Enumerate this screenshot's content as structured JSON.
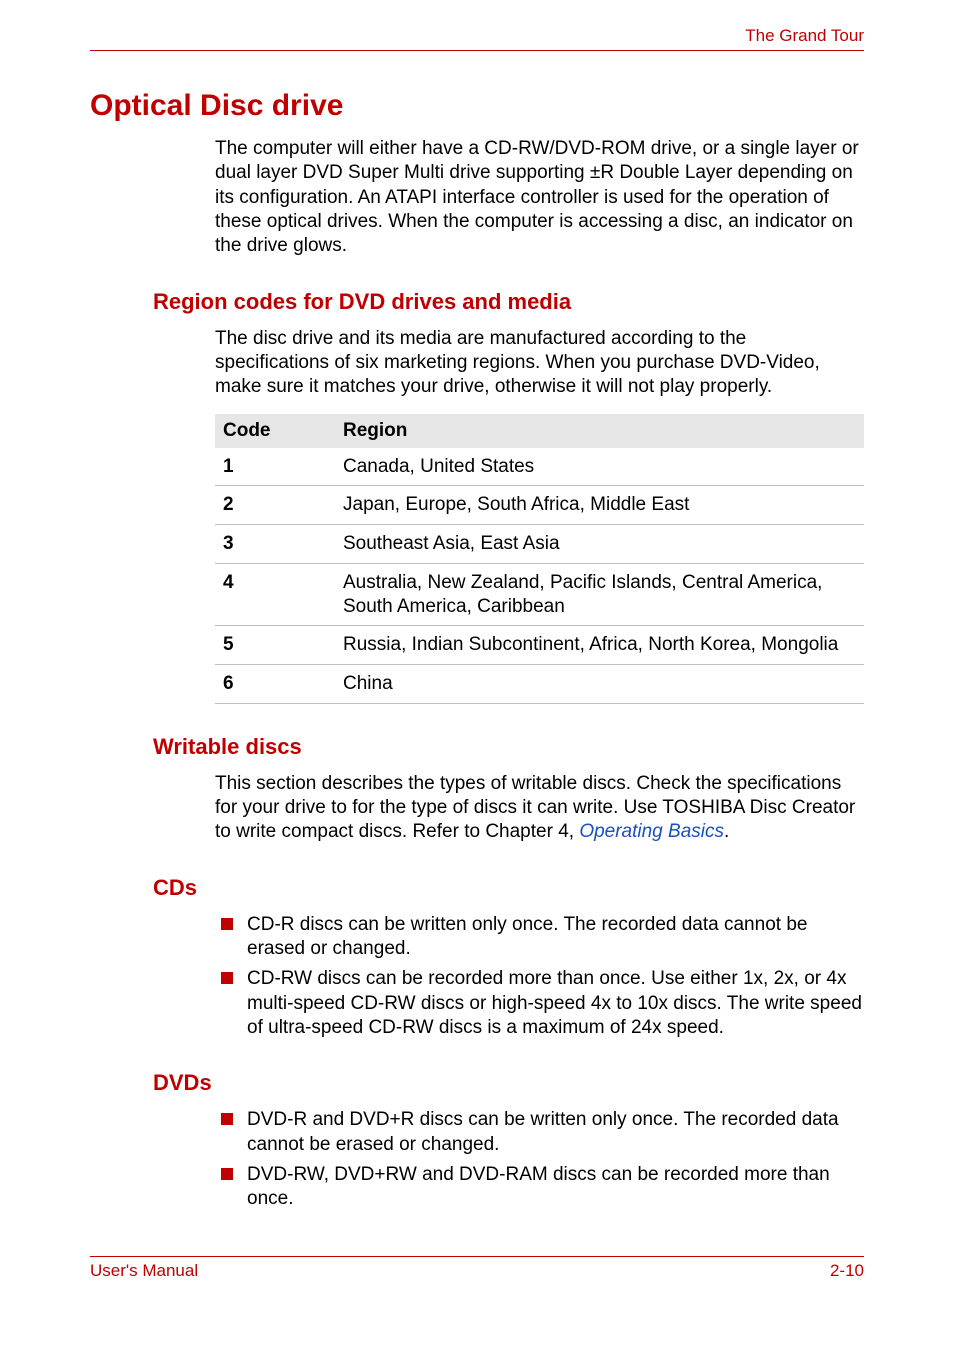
{
  "header": {
    "chapter": "The Grand Tour"
  },
  "section": {
    "title": "Optical Disc drive",
    "intro": "The computer will either have a CD-RW/DVD-ROM drive, or a single layer or dual layer DVD Super Multi drive supporting ±R Double Layer depending on its configuration. An ATAPI interface controller is used for the operation of these optical drives. When the computer is accessing a disc, an indicator on the drive glows."
  },
  "region": {
    "heading": "Region codes for DVD drives and media",
    "intro": "The disc drive and its media are manufactured according to the specifications of six marketing regions. When you purchase DVD-Video, make sure it matches your drive, otherwise it will not play properly.",
    "columns": {
      "code": "Code",
      "region": "Region"
    },
    "rows": [
      {
        "code": "1",
        "region": "Canada, United States"
      },
      {
        "code": "2",
        "region": "Japan, Europe, South Africa, Middle East"
      },
      {
        "code": "3",
        "region": "Southeast Asia, East Asia"
      },
      {
        "code": "4",
        "region": "Australia, New Zealand, Pacific Islands, Central America, South America, Caribbean"
      },
      {
        "code": "5",
        "region": "Russia, Indian Subcontinent, Africa, North Korea, Mongolia"
      },
      {
        "code": "6",
        "region": "China"
      }
    ]
  },
  "writable": {
    "heading": "Writable discs",
    "intro_pre": "This section describes the types of writable discs. Check the specifications for your drive to for the type of discs it can write. Use TOSHIBA Disc Creator  to write compact discs. Refer to Chapter 4, ",
    "link": "Operating Basics",
    "intro_post": "."
  },
  "cds": {
    "heading": "CDs",
    "items": [
      "CD-R discs can be written only once. The recorded data cannot be erased or changed.",
      "CD-RW discs can be recorded more than once. Use either 1x, 2x, or 4x multi-speed CD-RW discs or high-speed 4x to 10x discs. The write speed of ultra-speed CD-RW discs is a maximum of 24x speed."
    ]
  },
  "dvds": {
    "heading": "DVDs",
    "items": [
      "DVD-R and DVD+R discs can be written only once. The recorded data cannot be erased or changed.",
      "DVD-RW, DVD+RW and DVD-RAM discs can be recorded more than once."
    ]
  },
  "footer": {
    "left": "User's Manual",
    "right": "2-10"
  }
}
